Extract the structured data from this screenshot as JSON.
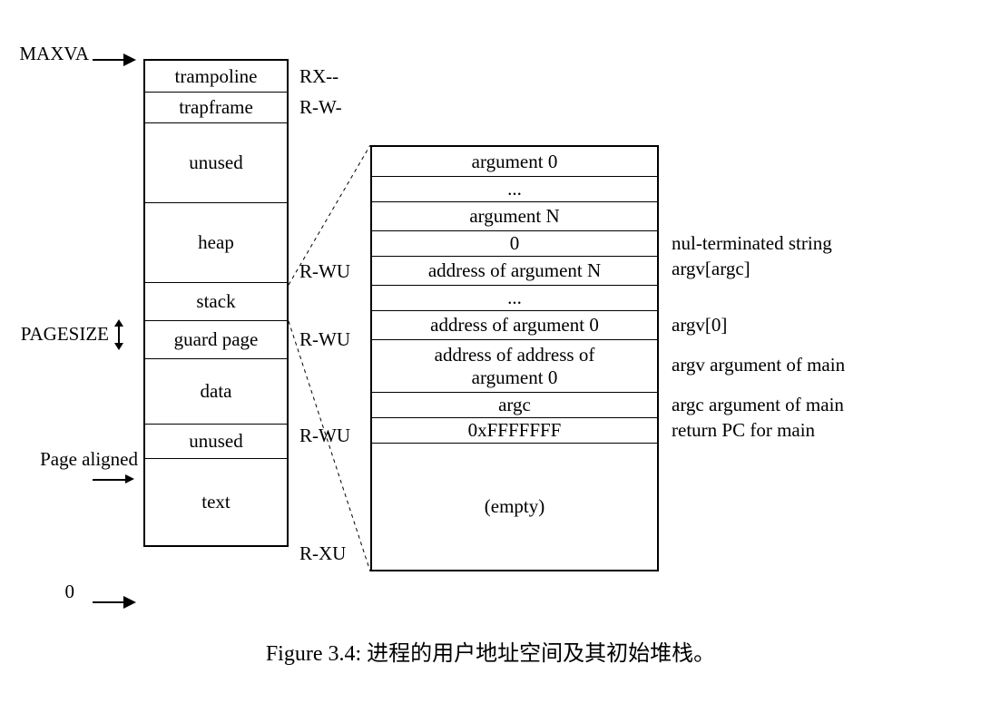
{
  "labels": {
    "maxva": "MAXVA",
    "pagesize": "PAGESIZE",
    "aligned": "Page aligned",
    "zero": "0"
  },
  "memory": {
    "trampoline": "trampoline",
    "trapframe": "trapframe",
    "unused1": "unused",
    "heap": "heap",
    "stack": "stack",
    "guard": "guard page",
    "data": "data",
    "unused2": "unused",
    "text": "text"
  },
  "perms": {
    "trampoline": "RX--",
    "trapframe": "R-W-",
    "heap": "R-WU",
    "stack": "R-WU",
    "data": "R-WU",
    "text": "R-XU"
  },
  "stack": {
    "arg0": "argument 0",
    "dots1": "...",
    "argN": "argument N",
    "zero": "0",
    "addrN": "address of argument N",
    "dots2": "...",
    "addr0": "address of argument 0",
    "addraddr_l1": "address of address of",
    "addraddr_l2": "argument 0",
    "argc": "argc",
    "retpc": "0xFFFFFFF",
    "empty": "(empty)"
  },
  "annotations": {
    "nulstr": "nul-terminated string",
    "argvargc": "argv[argc]",
    "argv0": "argv[0]",
    "argvmain": "argv argument of main",
    "argcmain": "argc argument of main",
    "retpcmain": "return PC for main"
  },
  "caption": "Figure 3.4: 进程的用户地址空间及其初始堆栈。"
}
